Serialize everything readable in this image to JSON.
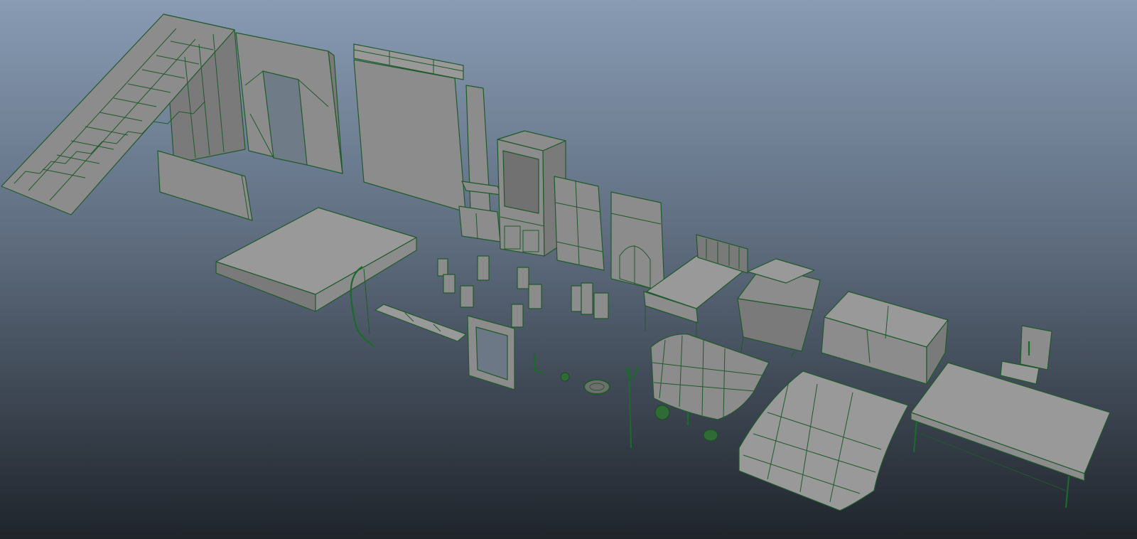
{
  "viewport": {
    "background_top": "#889bb3",
    "background_bottom": "#1f242b",
    "mesh_fill": "#8c8c8c",
    "wireframe_color": "#1f5a2a"
  }
}
